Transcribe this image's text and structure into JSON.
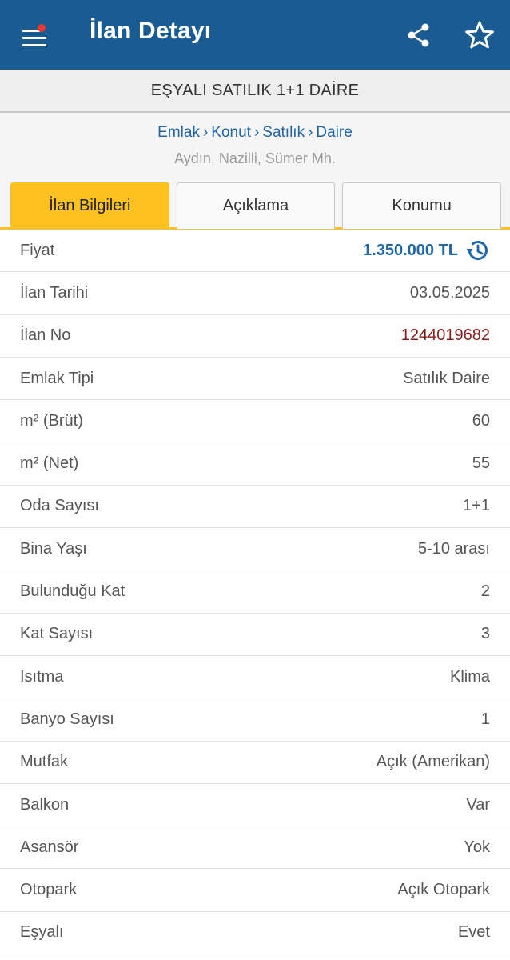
{
  "app_bar": {
    "title": "İlan Detayı",
    "icons": {
      "menu": "menu-icon",
      "share": "share-icon",
      "favorite": "star-icon"
    },
    "notification_dot_color": "#e53935",
    "color": "#1a5b92"
  },
  "listing_title": "EŞYALI SATILIK 1+1 DAİRE",
  "breadcrumb": [
    "Emlak",
    "Konut",
    "Satılık",
    "Daire"
  ],
  "breadcrumb_separator": "›",
  "location": "Aydın, Nazilli, Sümer Mh.",
  "tabs": [
    {
      "label": "İlan Bilgileri",
      "active": true
    },
    {
      "label": "Açıklama",
      "active": false
    },
    {
      "label": "Konumu",
      "active": false
    }
  ],
  "details": [
    {
      "label": "Fiyat",
      "value": "1.350.000 TL"
    },
    {
      "label": "İlan Tarihi",
      "value": "03.05.2025"
    },
    {
      "label": "İlan No",
      "value": "1244019682"
    },
    {
      "label": "Emlak Tipi",
      "value": "Satılık Daire"
    },
    {
      "label": "m² (Brüt)",
      "value": "60"
    },
    {
      "label": "m² (Net)",
      "value": "55"
    },
    {
      "label": "Oda Sayısı",
      "value": "1+1"
    },
    {
      "label": "Bina Yaşı",
      "value": "5-10 arası"
    },
    {
      "label": "Bulunduğu Kat",
      "value": "2"
    },
    {
      "label": "Kat Sayısı",
      "value": "3"
    },
    {
      "label": "Isıtma",
      "value": "Klima"
    },
    {
      "label": "Banyo Sayısı",
      "value": "1"
    },
    {
      "label": "Mutfak",
      "value": "Açık (Amerikan)"
    },
    {
      "label": "Balkon",
      "value": "Var"
    },
    {
      "label": "Asansör",
      "value": "Yok"
    },
    {
      "label": "Otopark",
      "value": "Açık Otopark"
    },
    {
      "label": "Eşyalı",
      "value": "Evet"
    }
  ],
  "colors": {
    "accent": "#fdc221",
    "price": "#1f67a8",
    "listing_no": "#8b1a1a",
    "link": "#2067a8"
  }
}
